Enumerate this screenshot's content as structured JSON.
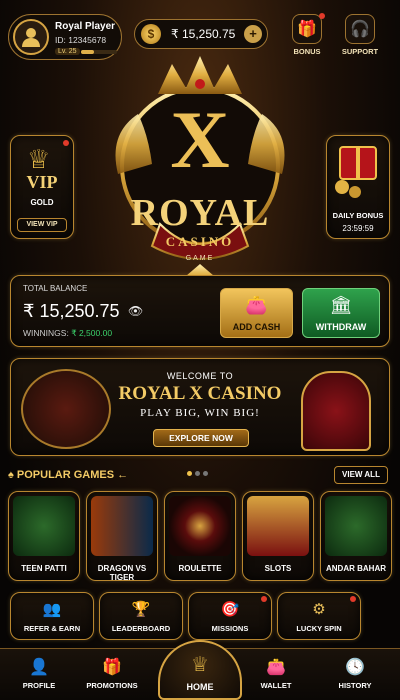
{
  "header": {
    "player_name": "Royal Player",
    "player_id": "ID: 12345678",
    "level": "Lv. 25",
    "level_progress": 0.35,
    "wallet_amount": "₹ 15,250.75",
    "coin_symbol": "$",
    "bonus_label": "BONUS",
    "support_label": "SUPPORT"
  },
  "vip": {
    "title": "VIP",
    "tier": "GOLD",
    "button": "VIEW VIP"
  },
  "daily_bonus": {
    "label": "DAILY BONUS",
    "timer": "23:59:59"
  },
  "logo": {
    "letter": "X",
    "brand": "ROYAL",
    "sub": "CASINO",
    "tag": "GAME"
  },
  "balance": {
    "label": "TOTAL BALANCE",
    "amount": "₹ 15,250.75",
    "winnings_label": "WINNINGS:",
    "winnings_value": "₹ 2,500.00",
    "add_cash": "ADD CASH",
    "withdraw": "WITHDRAW"
  },
  "banner": {
    "welcome": "WELCOME TO",
    "title": "ROYAL X CASINO",
    "subtitle": "PLAY BIG, WIN BIG!",
    "button": "EXPLORE NOW"
  },
  "popular": {
    "title": "POPULAR GAMES",
    "view_all": "VIEW ALL",
    "games": [
      "TEEN PATTI",
      "DRAGON VS TIGER",
      "ROULETTE",
      "SLOTS",
      "ANDAR BAHAR"
    ]
  },
  "quick_actions": [
    "REFER & EARN",
    "LEADERBOARD",
    "MISSIONS",
    "LUCKY SPIN"
  ],
  "nav": {
    "profile": "PROFILE",
    "promotions": "PROMOTIONS",
    "home": "HOME",
    "wallet": "WALLET",
    "history": "HISTORY"
  },
  "colors": {
    "gold": "#e9bf5a",
    "green": "#2fa24c",
    "accent_red": "#e23a2a"
  }
}
